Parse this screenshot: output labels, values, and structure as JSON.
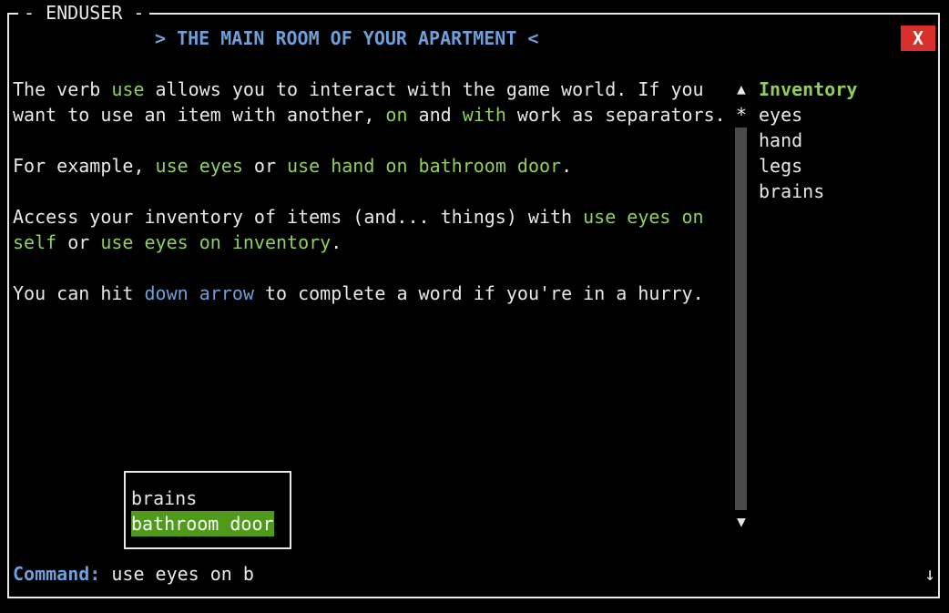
{
  "window": {
    "title": "ENDUSER",
    "room_title": "> THE MAIN ROOM OF YOUR APARTMENT <",
    "close_label": "X"
  },
  "text": {
    "p1": {
      "t1": "The verb ",
      "k1": "use",
      "t2": " allows you to interact with the game world. If you want to use an item with another, ",
      "k2": "on",
      "t3": " and ",
      "k3": "with",
      "t4": " work as separators."
    },
    "p2": {
      "t1": "For example, ",
      "k1": "use eyes",
      "t2": " or ",
      "k2": "use hand on bathroom door",
      "t3": "."
    },
    "p3": {
      "t1": "Access your inventory of items (and... things) with ",
      "k1": "use eyes on self",
      "t2": " or ",
      "k2": "use eyes on inventory",
      "t3": "."
    },
    "p4": {
      "t1": "You can hit ",
      "k1": "down arrow",
      "t2": " to complete a word if you're in a hurry."
    }
  },
  "scrollbar": {
    "up": "▲",
    "marker": "*",
    "down": "▼"
  },
  "inventory": {
    "title": "Inventory",
    "items": [
      "eyes",
      "hand",
      "legs",
      "brains"
    ]
  },
  "autocomplete": {
    "options": [
      "brains",
      "bathroom door"
    ],
    "selected_index": 1
  },
  "command": {
    "label": "Command:",
    "value": "use eyes on b"
  },
  "history_icon": "↓",
  "colors": {
    "keyword": "#8fcf5f",
    "hint": "#6f9fd8",
    "selected_bg": "#4f9a1a",
    "close_bg": "#d9302c"
  }
}
